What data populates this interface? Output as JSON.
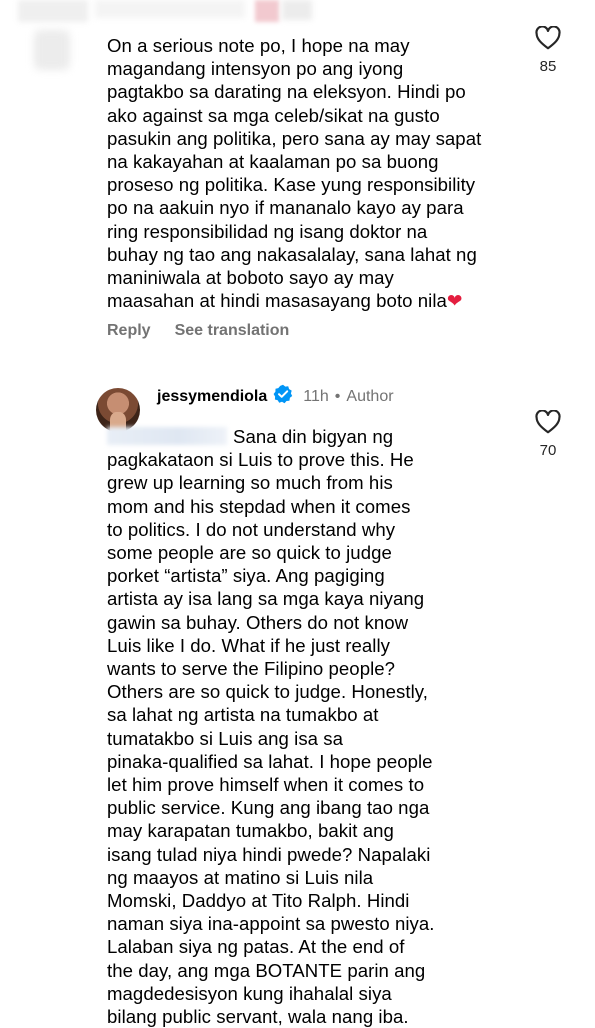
{
  "comment1": {
    "text": "On a serious note po, I hope na may\nmagandang intensyon po ang iyong\npagtakbo sa darating na eleksyon. Hindi po\nako against sa mga celeb/sikat na gusto\npasukin ang politika, pero sana ay may sapat\nna kakayahan at kaalaman po sa buong\nproseso ng politika. Kase yung responsibility\npo na aakuin nyo if mananalo kayo ay para\nring responsibilidad ng isang doktor na\nbuhay ng tao ang nakasalalay, sana lahat ng\nmaniniwala at boboto sayo ay may\nmaasahan at hindi masasayang boto nila",
    "emoji": "❤",
    "likes": "85",
    "reply_label": "Reply",
    "see_translation_label": "See translation"
  },
  "comment2": {
    "username": "jessymendiola",
    "time": "11h",
    "separator": "•",
    "author_label": "Author",
    "likes": "70",
    "text_first": "Sana din bigyan ng",
    "text_rest": "pagkakataon si Luis to prove this. He\ngrew up learning so much from his\nmom and his stepdad when it comes\nto politics. I do not understand why\nsome people are so quick to judge\nporket “artista” siya. Ang pagiging\nartista ay isa lang sa mga kaya niyang\ngawin sa buhay. Others do not know\nLuis like I do. What if he just really\nwants to serve the Filipino people?\nOthers are so quick to judge. Honestly,\nsa lahat ng artista na tumakbo at\ntumatakbo si Luis ang isa sa\npinaka-qualified sa lahat. I hope people\nlet him prove himself when it comes to\npublic service. Kung ang ibang tao nga\nmay karapatan tumakbo, bakit ang\nisang tulad niya hindi pwede? Napalaki\nng maayos at matino si Luis nila\nMomski, Daddyo at Tito Ralph. Hindi\nnaman siya ina-appoint sa pwesto niya.\nLalaban siya ng patas. At the end of\nthe day, ang mga BOTANTE parin ang\nmagdedesisyon kung ihahalal siya\nbilang public servant, wala nang iba."
  },
  "colors": {
    "text": "#000000",
    "secondary": "#737373",
    "verified": "#0095f6",
    "heart_emoji": "#e41e3f"
  },
  "icons": {
    "like": "heart-outline-icon",
    "verified": "verified-badge-icon"
  }
}
